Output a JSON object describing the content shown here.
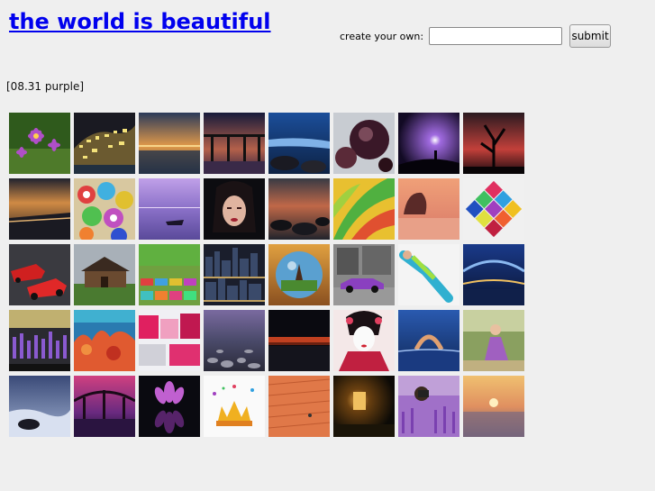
{
  "header": {
    "title": "the world is beautiful",
    "create_label": "create your own:",
    "input_value": "",
    "submit_label": "submit"
  },
  "date_label": "[08.31 purple]",
  "thumbnails": [
    {
      "icon": "flower-photo-icon"
    },
    {
      "icon": "coastal-town-photo-icon"
    },
    {
      "icon": "sunset-sea-photo-icon"
    },
    {
      "icon": "bridge-dusk-photo-icon"
    },
    {
      "icon": "blue-coast-photo-icon"
    },
    {
      "icon": "planet-spheres-photo-icon"
    },
    {
      "icon": "glowing-figure-photo-icon"
    },
    {
      "icon": "dead-tree-photo-icon"
    },
    {
      "icon": "shore-sunset-photo-icon"
    },
    {
      "icon": "colorful-cups-photo-icon"
    },
    {
      "icon": "boat-lake-photo-icon"
    },
    {
      "icon": "woman-portrait-photo-icon"
    },
    {
      "icon": "rocky-beach-photo-icon"
    },
    {
      "icon": "tropical-leaves-photo-icon"
    },
    {
      "icon": "rock-arch-photo-icon"
    },
    {
      "icon": "colorful-quilt-photo-icon"
    },
    {
      "icon": "red-cars-photo-icon"
    },
    {
      "icon": "wooden-house-photo-icon"
    },
    {
      "icon": "colorful-stools-photo-icon"
    },
    {
      "icon": "city-skyline-photo-icon"
    },
    {
      "icon": "crystal-ball-photo-icon"
    },
    {
      "icon": "purple-car-street-photo-icon"
    },
    {
      "icon": "floating-dancer-photo-icon"
    },
    {
      "icon": "night-bridge-photo-icon"
    },
    {
      "icon": "lavender-field-photo-icon"
    },
    {
      "icon": "coral-reef-photo-icon"
    },
    {
      "icon": "colorful-building-photo-icon"
    },
    {
      "icon": "pebble-beach-photo-icon"
    },
    {
      "icon": "dark-horizon-photo-icon"
    },
    {
      "icon": "geisha-photo-icon"
    },
    {
      "icon": "water-yoga-photo-icon"
    },
    {
      "icon": "girl-in-field-photo-icon"
    },
    {
      "icon": "wave-rock-photo-icon"
    },
    {
      "icon": "pink-bridge-photo-icon"
    },
    {
      "icon": "lotus-reflection-photo-icon"
    },
    {
      "icon": "splash-crown-photo-icon"
    },
    {
      "icon": "brick-wall-photo-icon"
    },
    {
      "icon": "lantern-dark-photo-icon"
    },
    {
      "icon": "photographer-lavender-photo-icon"
    },
    {
      "icon": "hazy-sunset-sea-photo-icon"
    }
  ]
}
